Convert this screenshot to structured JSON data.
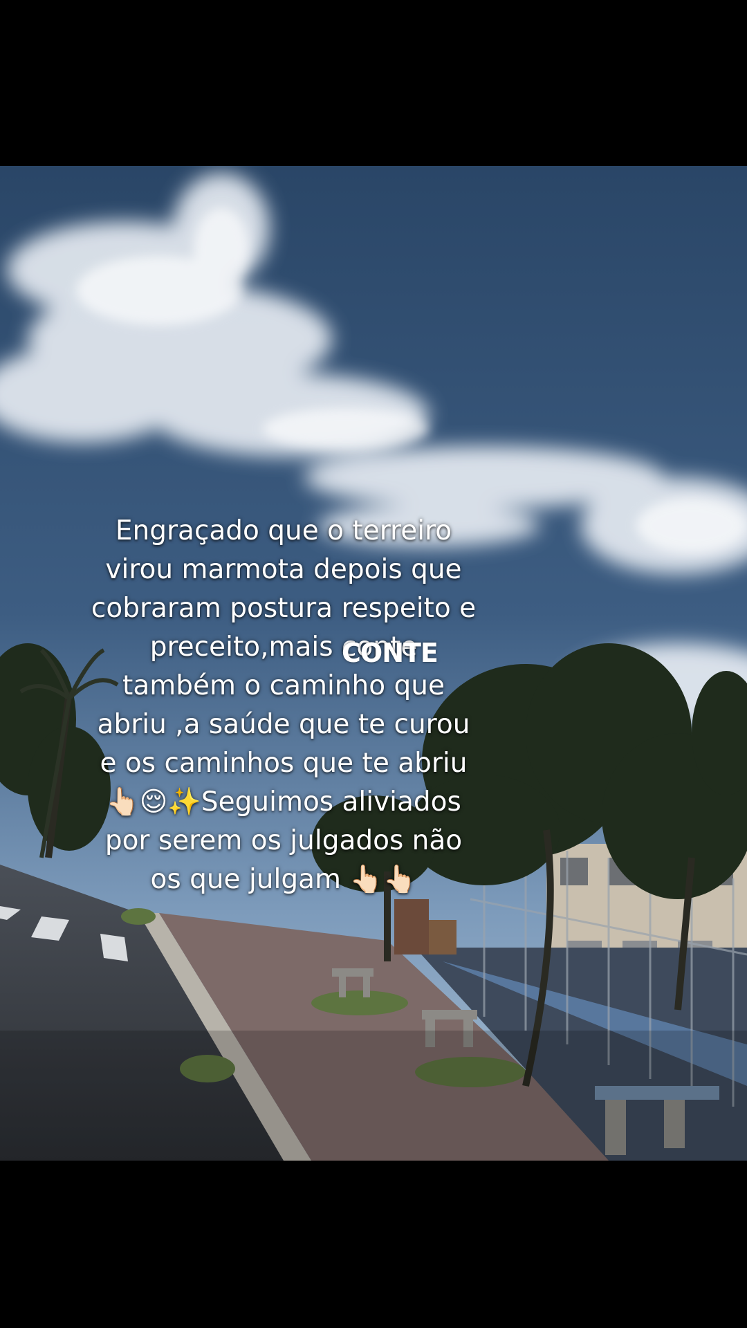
{
  "post": {
    "caption_lines": [
      "Engraçado que o terreiro",
      "virou marmota depois que",
      "cobraram postura respeito e",
      "preceito,mais conte",
      "também o caminho que",
      "abriu ,a saúde que te curou",
      "e os caminhos que te abriu",
      "👆🏻😌✨Seguimos aliviados",
      "por serem os julgados não",
      "os que julgam 👆🏻👆🏻"
    ],
    "overlay_text": "CONTE"
  },
  "icons": {
    "photo": "outdoor-park-sky-photo"
  },
  "colors": {
    "background": "#000000",
    "sky_top": "#2d4a6b",
    "sky_bottom": "#6f8fb0",
    "text": "#ffffff"
  }
}
